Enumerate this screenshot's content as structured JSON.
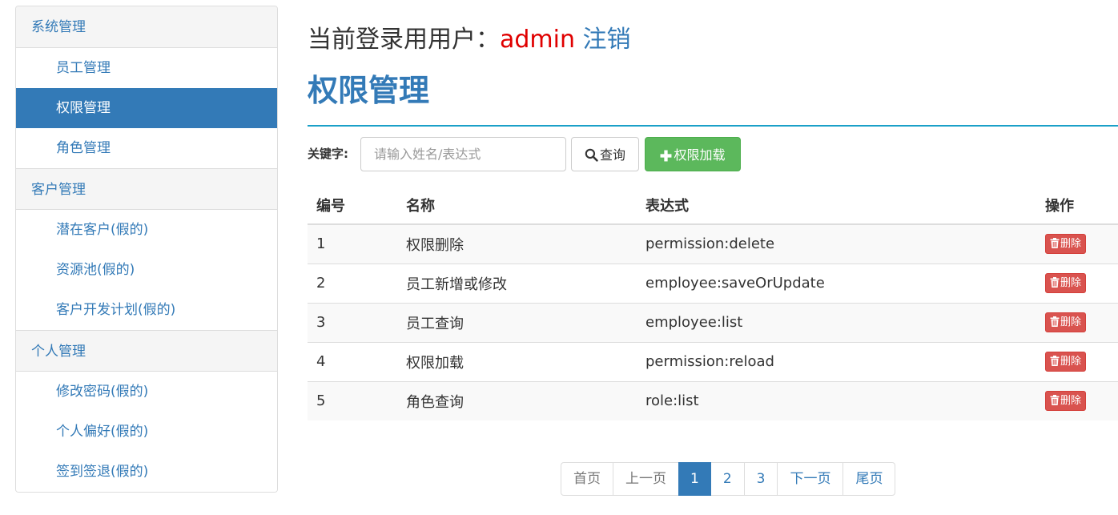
{
  "sidebar": {
    "groups": [
      {
        "title": "系统管理",
        "items": [
          {
            "label": "员工管理"
          },
          {
            "label": "权限管理",
            "active": true
          },
          {
            "label": "角色管理"
          }
        ]
      },
      {
        "title": "客户管理",
        "items": [
          {
            "label": "潜在客户(假的)"
          },
          {
            "label": "资源池(假的)"
          },
          {
            "label": "客户开发计划(假的)"
          }
        ]
      },
      {
        "title": "个人管理",
        "items": [
          {
            "label": "修改密码(假的)"
          },
          {
            "label": "个人偏好(假的)"
          },
          {
            "label": "签到签退(假的)"
          }
        ]
      }
    ]
  },
  "header": {
    "login_prefix": "当前登录用用户：",
    "username": "admin",
    "logout_label": "注销",
    "page_title": "权限管理"
  },
  "search": {
    "keyword_label": "关键字:",
    "placeholder": "请输入姓名/表达式",
    "value": "",
    "search_label": "查询",
    "reload_label": "权限加载"
  },
  "table": {
    "headers": {
      "id": "编号",
      "name": "名称",
      "expression": "表达式",
      "actions": "操作"
    },
    "delete_label": "删除",
    "rows": [
      {
        "id": "1",
        "name": "权限删除",
        "expression": "permission:delete"
      },
      {
        "id": "2",
        "name": "员工新增或修改",
        "expression": "employee:saveOrUpdate"
      },
      {
        "id": "3",
        "name": "员工查询",
        "expression": "employee:list"
      },
      {
        "id": "4",
        "name": "权限加载",
        "expression": "permission:reload"
      },
      {
        "id": "5",
        "name": "角色查询",
        "expression": "role:list"
      }
    ]
  },
  "pagination": {
    "first": "首页",
    "prev": "上一页",
    "pages": [
      "1",
      "2",
      "3"
    ],
    "current": "1",
    "next": "下一页",
    "last": "尾页"
  },
  "colors": {
    "primary": "#337ab7",
    "success": "#5cb85c",
    "danger": "#d9534f",
    "username": "#e00000",
    "rule": "#1aa0c8"
  },
  "icons": {
    "search": "search-icon",
    "plus": "plus-icon",
    "trash": "trash-icon"
  }
}
